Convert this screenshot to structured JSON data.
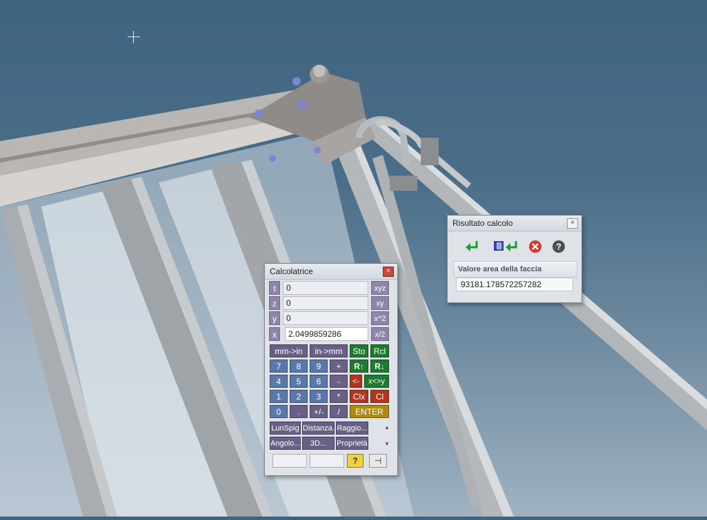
{
  "calculator": {
    "title": "Calcolatrice",
    "close_label": "×",
    "registers": [
      {
        "label": "t",
        "value": "0",
        "op": "xyz"
      },
      {
        "label": "z",
        "value": "0",
        "op": "xy"
      },
      {
        "label": "y",
        "value": "0",
        "op": "x^2"
      },
      {
        "label": "x",
        "value": "2.0499859286",
        "op": "x/2"
      }
    ],
    "keys": {
      "mm_in": "mm->in",
      "in_mm": "in->mm",
      "sto": "Sto",
      "rcl": "Rcl",
      "k7": "7",
      "k8": "8",
      "k9": "9",
      "plus": "+",
      "roll_up": "R↑",
      "roll_down": "R↓",
      "k4": "4",
      "k5": "5",
      "k6": "6",
      "minus": "-",
      "backspace": "<-",
      "swap": "x<>y",
      "k1": "1",
      "k2": "2",
      "k3": "3",
      "mult": "*",
      "clx": "Clx",
      "cl": "Cl",
      "k0": "0",
      "dot": ".",
      "sign": "+/-",
      "div": "/",
      "enter": "ENTER"
    },
    "functions": [
      "LunSpig",
      "Distanza..",
      "Raggio...",
      "Angolo...",
      "3D...",
      "Proprietà..."
    ],
    "help_label": "?",
    "pin_label": "⊣"
  },
  "result_dialog": {
    "title": "Risultato calcolo",
    "close_label": "×",
    "toolbar": {
      "accept_icon": "return-arrow-icon",
      "table_accept_icon": "table-return-icon",
      "cancel_icon": "cancel-icon",
      "help_icon": "help-icon"
    },
    "section_title": "Valore area della faccia",
    "value": "93181.178572257282"
  },
  "colors": {
    "sky_top": "#3f6480",
    "sky_bottom": "#9fb2c1",
    "key_blue": "#5b78aa",
    "key_purple": "#6a6087",
    "key_green": "#1d7a2f",
    "key_red": "#b03620",
    "key_gold": "#b08a10"
  }
}
